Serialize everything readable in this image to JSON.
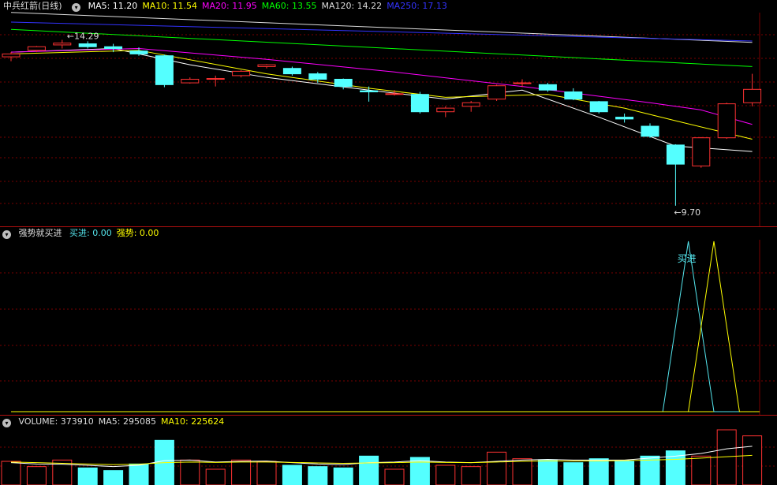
{
  "price_panel": {
    "title": "中兵红箭(日线)",
    "ma_items": [
      {
        "label": "MA5: 11.20",
        "color": "#ffffff"
      },
      {
        "label": "MA10: 11.54",
        "color": "#ffff00"
      },
      {
        "label": "MA20: 11.95",
        "color": "#ff00ff"
      },
      {
        "label": "MA60: 13.55",
        "color": "#00ff00"
      },
      {
        "label": "MA120: 14.22",
        "color": "#dddddd"
      },
      {
        "label": "MA250: 17.13",
        "color": "#3333ff"
      }
    ],
    "high_label": "14.29",
    "low_label": "9.70"
  },
  "indicator_panel": {
    "title": "强势就买进",
    "items": [
      {
        "label": "买进: 0.00",
        "color": "#55e6ee"
      },
      {
        "label": "强势: 0.00",
        "color": "#ffff00"
      }
    ],
    "signal_label": "买进"
  },
  "volume_panel": {
    "items": [
      {
        "label": "VOLUME: 373910",
        "color": "#dddddd"
      },
      {
        "label": "MA5: 295085",
        "color": "#dddddd"
      },
      {
        "label": "MA10: 225624",
        "color": "#ffff00"
      }
    ]
  },
  "chart_data": {
    "type": "candlestick",
    "price_range": [
      9.5,
      15.0
    ],
    "candles": [
      {
        "o": 13.82,
        "h": 13.95,
        "l": 13.7,
        "c": 13.9
      },
      {
        "o": 14.0,
        "h": 14.12,
        "l": 13.95,
        "c": 14.1
      },
      {
        "o": 14.15,
        "h": 14.29,
        "l": 14.05,
        "c": 14.2
      },
      {
        "o": 14.18,
        "h": 14.25,
        "l": 14.05,
        "c": 14.1
      },
      {
        "o": 14.1,
        "h": 14.18,
        "l": 13.95,
        "c": 14.05
      },
      {
        "o": 13.98,
        "h": 14.08,
        "l": 13.85,
        "c": 13.9
      },
      {
        "o": 13.85,
        "h": 13.88,
        "l": 12.98,
        "c": 13.05
      },
      {
        "o": 13.1,
        "h": 13.25,
        "l": 13.08,
        "c": 13.2
      },
      {
        "o": 13.2,
        "h": 13.3,
        "l": 13.0,
        "c": 13.22
      },
      {
        "o": 13.3,
        "h": 13.45,
        "l": 13.25,
        "c": 13.42
      },
      {
        "o": 13.55,
        "h": 13.62,
        "l": 13.5,
        "c": 13.6
      },
      {
        "o": 13.5,
        "h": 13.55,
        "l": 13.3,
        "c": 13.35
      },
      {
        "o": 13.35,
        "h": 13.4,
        "l": 13.1,
        "c": 13.2
      },
      {
        "o": 13.2,
        "h": 13.22,
        "l": 12.92,
        "c": 13.0
      },
      {
        "o": 12.88,
        "h": 13.0,
        "l": 12.58,
        "c": 12.85
      },
      {
        "o": 12.8,
        "h": 12.9,
        "l": 12.75,
        "c": 12.8
      },
      {
        "o": 12.78,
        "h": 12.85,
        "l": 12.25,
        "c": 12.3
      },
      {
        "o": 12.3,
        "h": 12.45,
        "l": 12.15,
        "c": 12.4
      },
      {
        "o": 12.45,
        "h": 12.6,
        "l": 12.3,
        "c": 12.55
      },
      {
        "o": 12.65,
        "h": 13.05,
        "l": 12.6,
        "c": 13.02
      },
      {
        "o": 13.08,
        "h": 13.2,
        "l": 12.98,
        "c": 13.1
      },
      {
        "o": 13.05,
        "h": 13.1,
        "l": 12.85,
        "c": 12.9
      },
      {
        "o": 12.85,
        "h": 12.95,
        "l": 12.62,
        "c": 12.65
      },
      {
        "o": 12.58,
        "h": 12.6,
        "l": 12.25,
        "c": 12.3
      },
      {
        "o": 12.15,
        "h": 12.25,
        "l": 12.0,
        "c": 12.1
      },
      {
        "o": 11.9,
        "h": 11.98,
        "l": 11.58,
        "c": 11.62
      },
      {
        "o": 11.38,
        "h": 11.4,
        "l": 9.7,
        "c": 10.85
      },
      {
        "o": 10.8,
        "h": 11.6,
        "l": 10.75,
        "c": 11.58
      },
      {
        "o": 11.58,
        "h": 12.55,
        "l": 11.55,
        "c": 12.52
      },
      {
        "o": 12.55,
        "h": 13.35,
        "l": 12.45,
        "c": 12.92
      }
    ],
    "ma_lines": [
      {
        "name": "MA5",
        "color": "#ffffff",
        "x": [
          0,
          4,
          7,
          10,
          14,
          17,
          20,
          23,
          26,
          29
        ],
        "y": [
          13.95,
          14.05,
          13.6,
          13.25,
          12.9,
          12.65,
          12.9,
          12.15,
          11.35,
          11.2
        ]
      },
      {
        "name": "MA10",
        "color": "#ffff00",
        "x": [
          0,
          5,
          10,
          14,
          17,
          21,
          24,
          26,
          29
        ],
        "y": [
          13.9,
          14.0,
          13.35,
          12.95,
          12.7,
          12.78,
          12.4,
          12.05,
          11.54
        ]
      },
      {
        "name": "MA20",
        "color": "#ff00ff",
        "x": [
          0,
          5,
          10,
          15,
          20,
          25,
          27,
          29
        ],
        "y": [
          13.95,
          14.05,
          13.75,
          13.4,
          13.0,
          12.55,
          12.35,
          11.95
        ]
      },
      {
        "name": "MA60",
        "color": "#00ff00",
        "x": [
          0,
          29
        ],
        "y": [
          14.58,
          13.55
        ]
      },
      {
        "name": "MA120",
        "color": "#dddddd",
        "x": [
          0,
          29
        ],
        "y": [
          15.05,
          14.22
        ]
      },
      {
        "name": "MA250",
        "color": "#3333ff",
        "x": [
          0,
          29
        ],
        "y": [
          17.25,
          17.13
        ]
      }
    ],
    "indicator": {
      "range": [
        0,
        1
      ],
      "series": [
        {
          "name": "买进",
          "color": "#55e6ee",
          "x": [
            0,
            25.5,
            26.5,
            27.5,
            29
          ],
          "y": [
            0,
            0,
            1,
            0,
            0
          ]
        },
        {
          "name": "强势",
          "color": "#ffff00",
          "x": [
            0,
            26.5,
            27.5,
            28.5,
            29
          ],
          "y": [
            0,
            0,
            1,
            0,
            0
          ]
        }
      ]
    },
    "volume": {
      "range": [
        0,
        420000
      ],
      "values": [
        180000,
        140000,
        190000,
        130000,
        110000,
        160000,
        340000,
        190000,
        120000,
        190000,
        180000,
        150000,
        140000,
        130000,
        220000,
        120000,
        210000,
        150000,
        140000,
        250000,
        200000,
        190000,
        170000,
        200000,
        180000,
        220000,
        260000,
        220000,
        420000,
        373910
      ],
      "ma5": [
        170000,
        160000,
        158000,
        150000,
        140000,
        150000,
        185000,
        190000,
        175000,
        180000,
        182000,
        170000,
        160000,
        155000,
        170000,
        175000,
        185000,
        175000,
        170000,
        180000,
        190000,
        195000,
        190000,
        190000,
        190000,
        205000,
        220000,
        240000,
        275000,
        295085
      ],
      "ma10": [
        175000,
        170000,
        165000,
        160000,
        155000,
        158000,
        170000,
        175000,
        172000,
        175000,
        175000,
        172000,
        168000,
        165000,
        168000,
        170000,
        175000,
        172000,
        170000,
        175000,
        180000,
        183000,
        182000,
        183000,
        185000,
        190000,
        195000,
        205000,
        215000,
        225624
      ]
    }
  }
}
